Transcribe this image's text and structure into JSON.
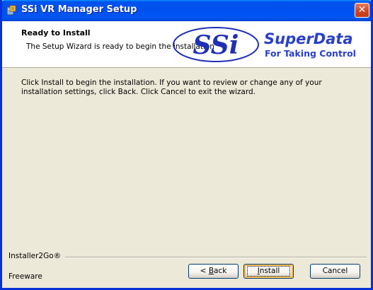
{
  "window": {
    "title": "SSi VR Manager Setup",
    "close_glyph": "✕"
  },
  "banner": {
    "title": "Ready to Install",
    "subtitle": "The Setup Wizard is ready to begin the installation",
    "logo_text": "SSi",
    "logo_brand": "SuperData",
    "logo_tagline": "For Taking Control"
  },
  "body": {
    "text": "Click Install to begin the installation.  If you want to review or change any of your installation settings, click Back.  Click Cancel to exit the wizard."
  },
  "footer": {
    "brand": "Installer2Go®",
    "edition": "Freeware"
  },
  "buttons": {
    "back_prefix": "< ",
    "back_hotkey": "B",
    "back_rest": "ack",
    "install_hotkey": "I",
    "install_rest": "nstall",
    "cancel": "Cancel"
  },
  "colors": {
    "titlebar": "#0053ee",
    "face": "#ece9d8",
    "logo_blue": "#1f2fb8"
  },
  "icons": {
    "app": "setup-package-icon",
    "close": "close-icon"
  }
}
